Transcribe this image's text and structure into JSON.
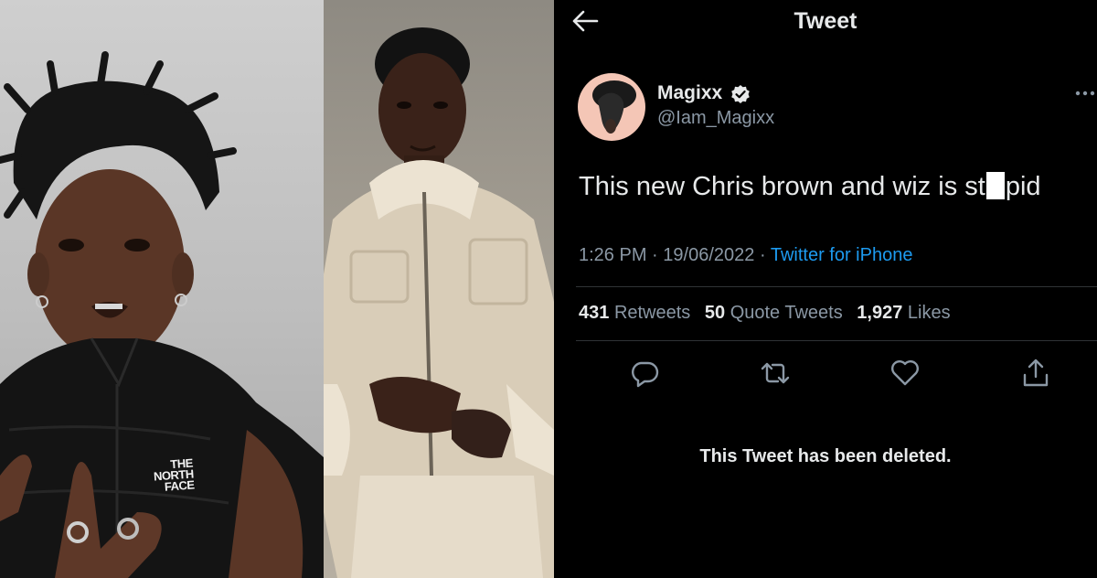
{
  "photos": {
    "left_vest_logo": [
      "THE",
      "NORTH",
      "FACE"
    ]
  },
  "tweet_view": {
    "header_title": "Tweet",
    "author": {
      "display_name": "Magixx",
      "handle": "@Iam_Magixx",
      "verified": true
    },
    "text_before": "This new Chris brown and wiz is st",
    "text_after": "pid",
    "time": "1:26 PM",
    "date": "19/06/2022",
    "separator": "·",
    "source": "Twitter for iPhone",
    "stats": {
      "retweets_count": "431",
      "retweets_label": "Retweets",
      "quotes_count": "50",
      "quotes_label": "Quote Tweets",
      "likes_count": "1,927",
      "likes_label": "Likes"
    },
    "deleted_notice": "This Tweet has been deleted."
  },
  "colors": {
    "background": "#000000",
    "text": "#e7e9ea",
    "secondary_text": "#8b98a5",
    "link": "#1d9bf0",
    "divider": "#2f3336"
  },
  "icons": [
    "back-arrow-icon",
    "verified-badge-icon",
    "more-icon",
    "reply-icon",
    "retweet-icon",
    "like-icon",
    "share-icon"
  ]
}
